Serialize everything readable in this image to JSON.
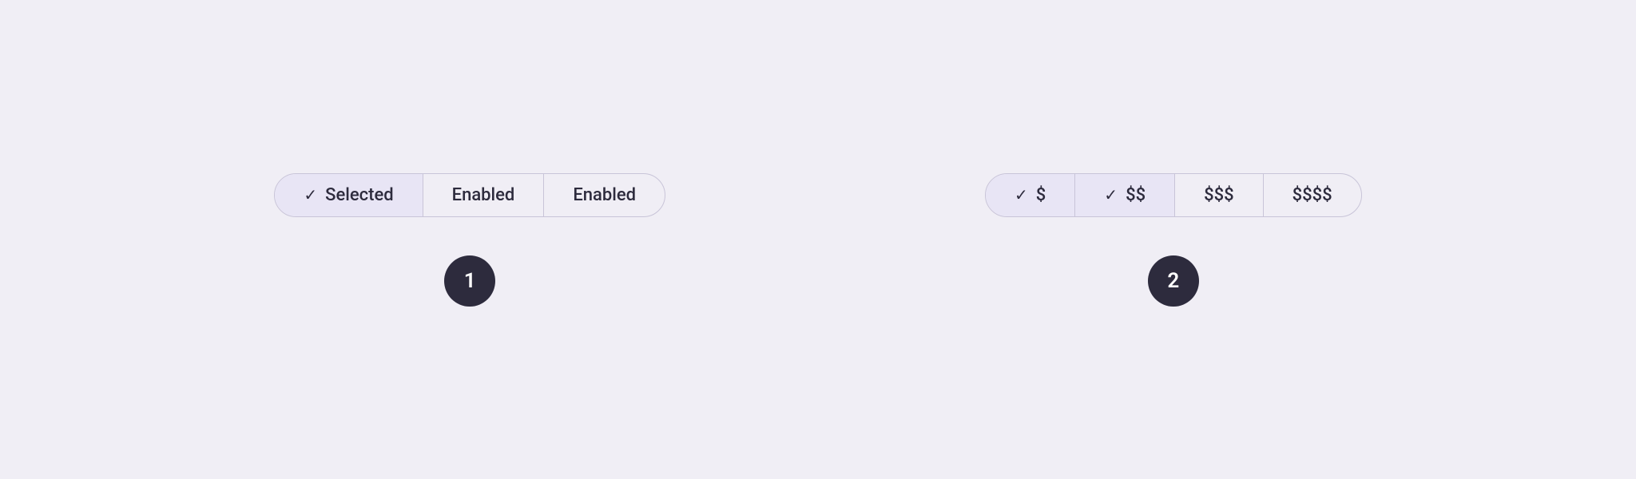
{
  "background_color": "#f0eef5",
  "groups": [
    {
      "id": "group-1",
      "badge_label": "1",
      "segments": [
        {
          "id": "seg-selected",
          "label": "Selected",
          "has_check": true,
          "selected": true
        },
        {
          "id": "seg-enabled-1",
          "label": "Enabled",
          "has_check": false,
          "selected": false
        },
        {
          "id": "seg-enabled-2",
          "label": "Enabled",
          "has_check": false,
          "selected": false
        }
      ]
    },
    {
      "id": "group-2",
      "badge_label": "2",
      "segments": [
        {
          "id": "seg-dollar-1",
          "label": "$",
          "has_check": true,
          "selected": true
        },
        {
          "id": "seg-dollar-2",
          "label": "$$",
          "has_check": true,
          "selected": true
        },
        {
          "id": "seg-dollar-3",
          "label": "$$$",
          "has_check": false,
          "selected": false
        },
        {
          "id": "seg-dollar-4",
          "label": "$$$$",
          "has_check": false,
          "selected": false
        }
      ]
    }
  ]
}
